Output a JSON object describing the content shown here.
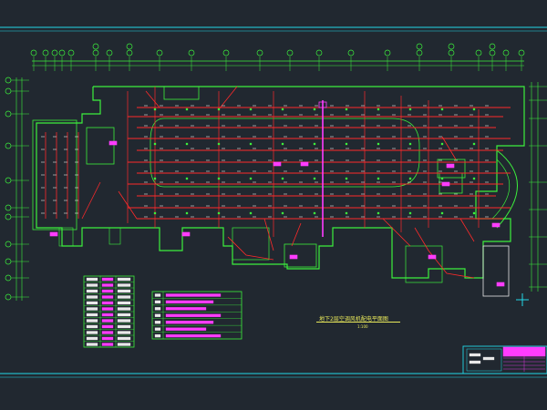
{
  "drawing": {
    "title": "地下2层空调风机配电平面图",
    "scale": "1:100",
    "colors": {
      "background": "#212830",
      "grid_axis": "#2ee84a",
      "wall": "#3cf03c",
      "cable_tray": "#ff2a2a",
      "riser": "#ff3cff",
      "symbol": "#e8e8e8",
      "frame": "#22d8e8"
    }
  },
  "legend_left": {
    "rows": 12
  },
  "legend_right": {
    "rows": 7
  },
  "title_block": {
    "present": true
  }
}
